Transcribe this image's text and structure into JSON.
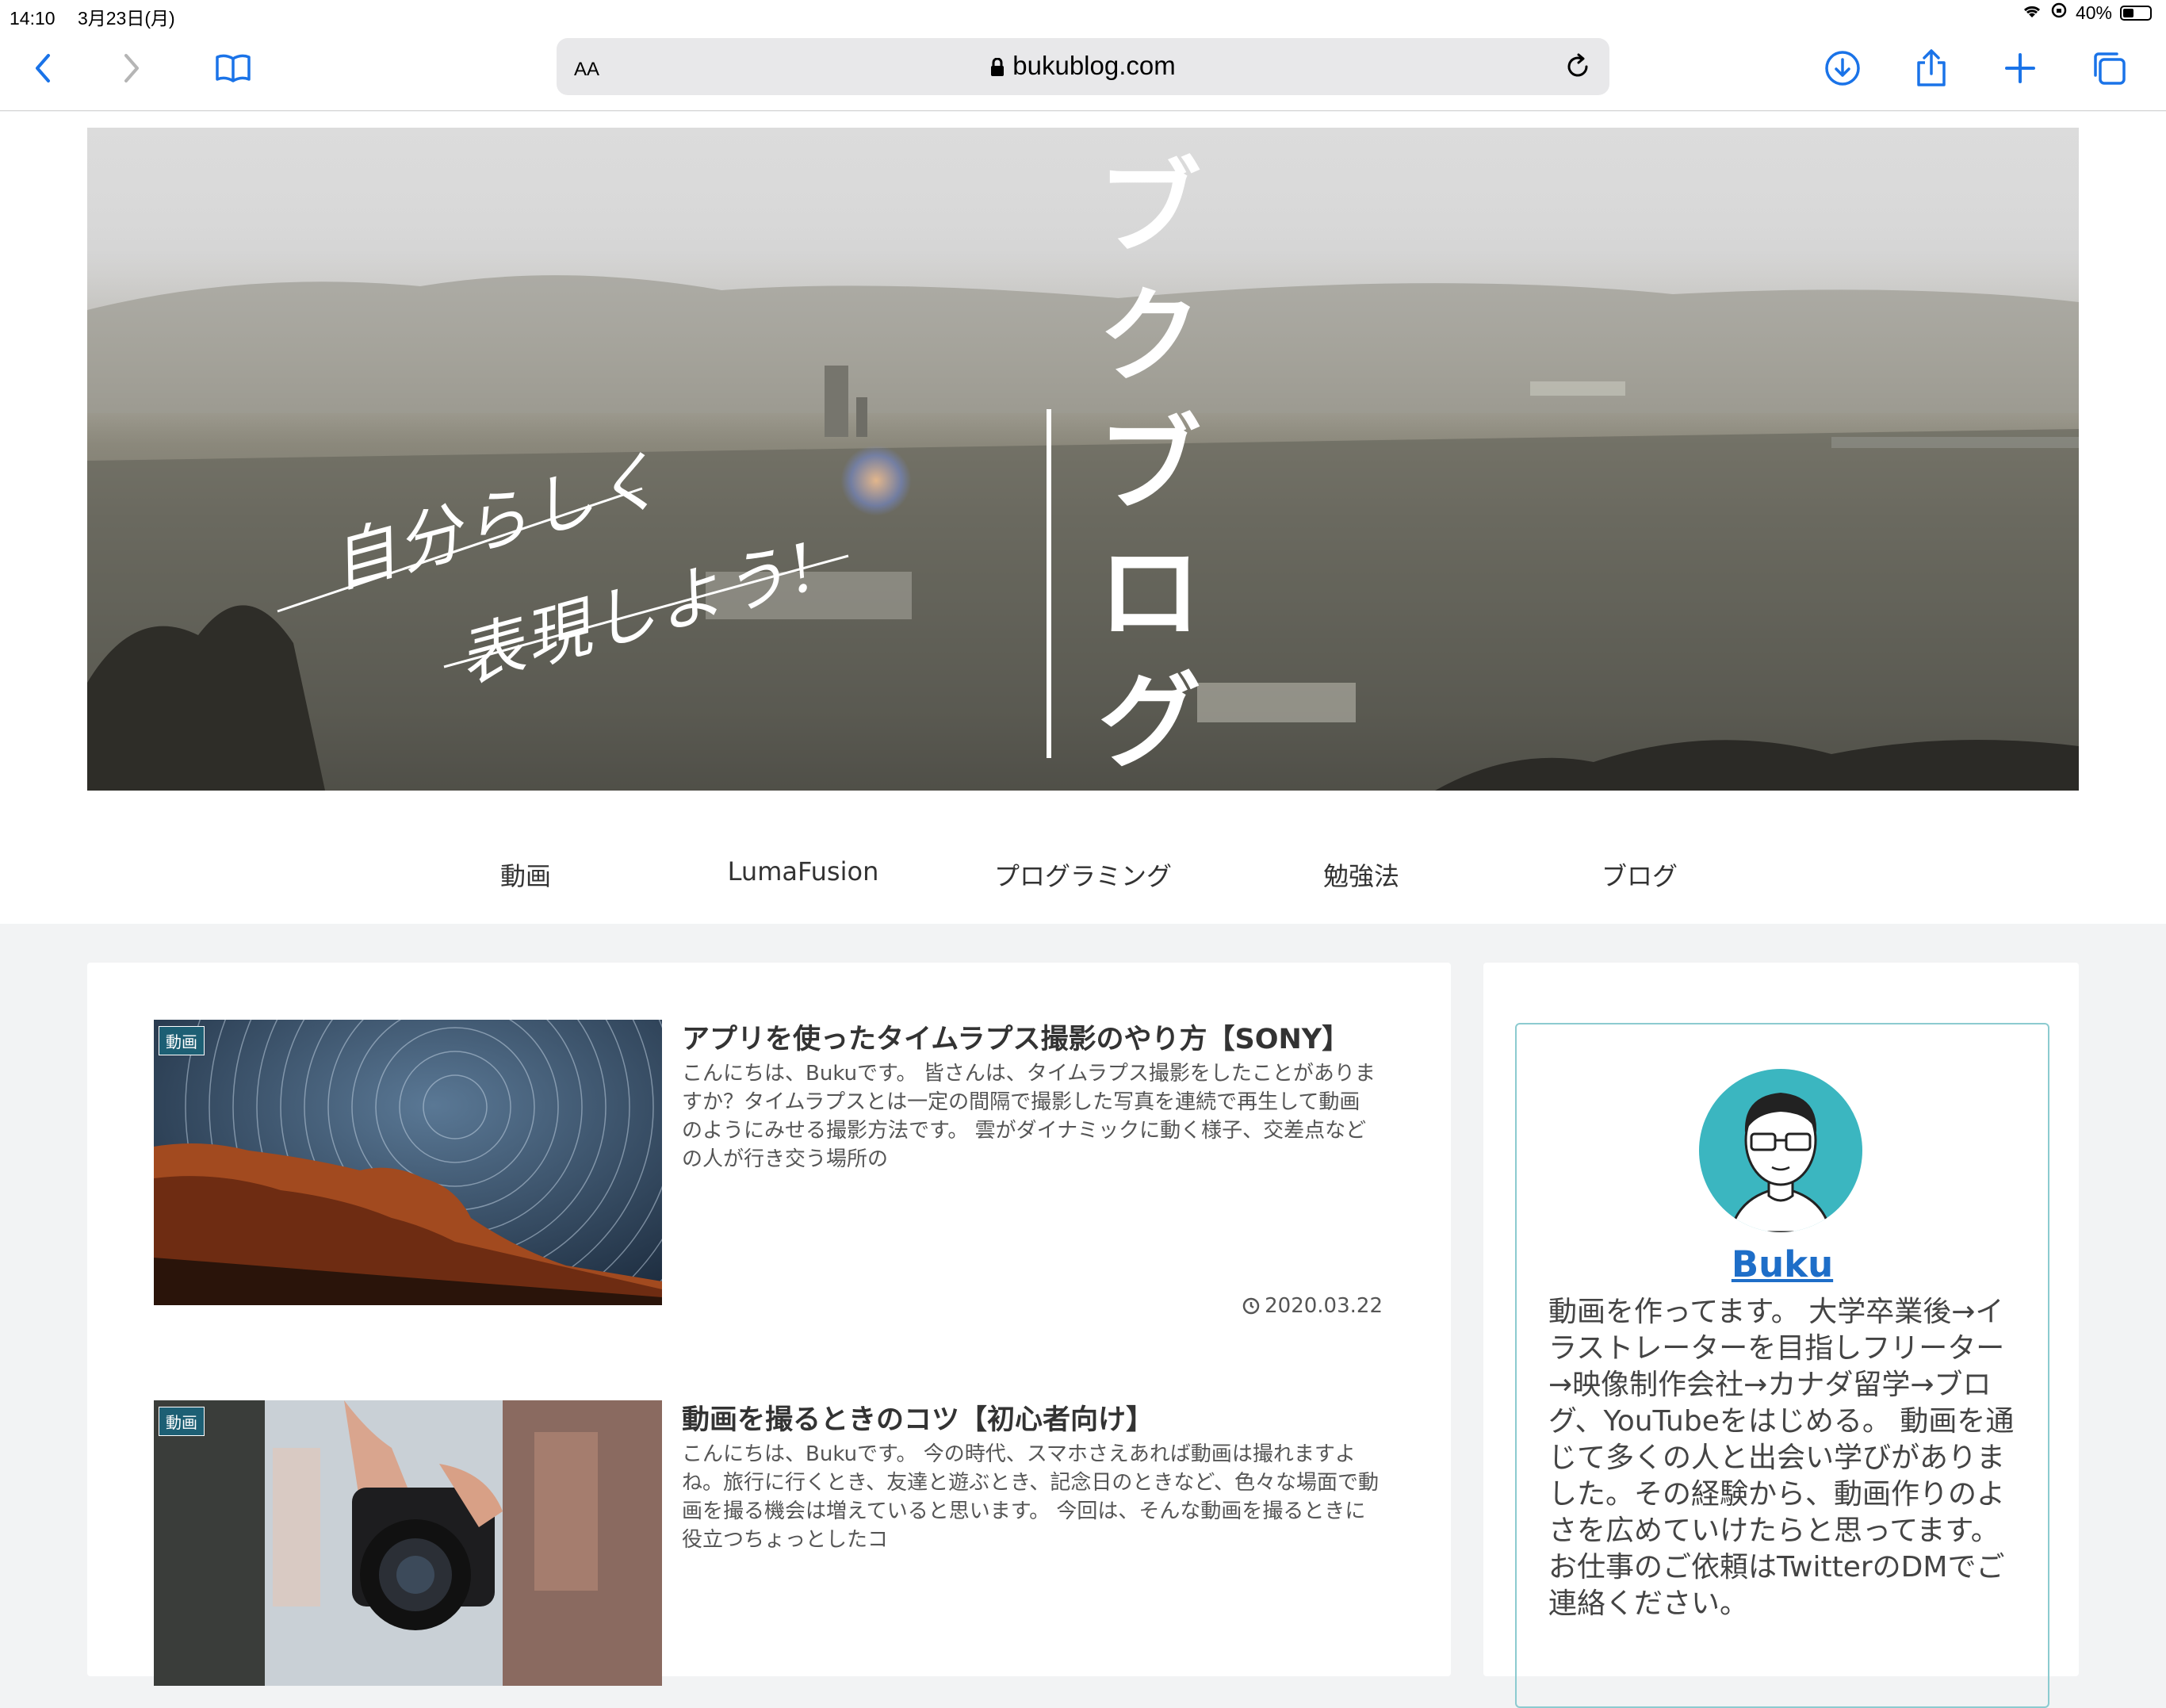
{
  "status_bar": {
    "time": "14:10",
    "date": "3月23日(月)",
    "battery_percent": "40%",
    "battery_level": 0.4
  },
  "browser": {
    "text_size_label": "AA",
    "url": "bukublog.com",
    "icons": [
      "back-icon",
      "forward-icon",
      "bookmarks-icon",
      "reload-icon",
      "download-icon",
      "share-icon",
      "new-tab-icon",
      "tabs-icon"
    ]
  },
  "hero": {
    "title_chars": [
      "ブ",
      "ク",
      "ブ",
      "ロ",
      "グ"
    ],
    "handwritten_line1": "自分らしく",
    "handwritten_line2": "表現しよう!"
  },
  "nav": {
    "items": [
      "動画",
      "LumaFusion",
      "プログラミング",
      "勉強法",
      "ブログ"
    ]
  },
  "posts": [
    {
      "category": "動画",
      "title": "アプリを使ったタイムラプス撮影のやり方【SONY】",
      "excerpt": "こんにちは、Bukuです。 皆さんは、タイムラプス撮影をしたことがありますか？タイムラプスとは一定の間隔で撮影した写真を連続で再生して動画のようにみせる撮影方法です。 雲がダイナミックに動く様子、交差点などの人が行き交う場所の",
      "date": "2020.03.22"
    },
    {
      "category": "動画",
      "title": "動画を撮るときのコツ【初心者向け】",
      "excerpt": "こんにちは、Bukuです。 今の時代、スマホさえあれば動画は撮れますよね。旅行に行くとき、友達と遊ぶとき、記念日のときなど、色々な場面で動画を撮る機会は増えていると思います。 今回は、そんな動画を撮るときに役立つちょっとしたコ"
    }
  ],
  "profile": {
    "name": "Buku",
    "bio": "動画を作ってます。 大学卒業後→イラストレーターを目指しフリーター→映像制作会社→カナダ留学→ブログ、YouTubeをはじめる。 動画を通じて多くの人と出会い学びがありました。その経験から、動画作りのよさを広めていけたらと思ってます。お仕事のご依頼はTwitterのDMでご連絡ください。"
  },
  "colors": {
    "accent_blue": "#1a73e8",
    "category_badge": "#1d5f74",
    "profile_border": "#8ccbd0",
    "avatar_bg": "#3bb6c0",
    "link": "#1e6ec8"
  }
}
